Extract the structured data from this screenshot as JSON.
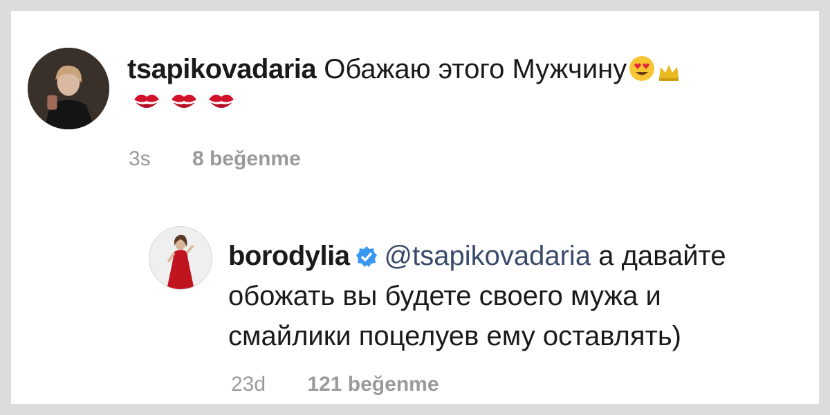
{
  "comment": {
    "username": "tsapikovadaria",
    "text": "Обажаю этого Мужчину",
    "emojis": [
      "heart-eyes-emoji",
      "crown-emoji",
      "kiss-mark-emoji",
      "kiss-mark-emoji",
      "kiss-mark-emoji"
    ],
    "time": "3s",
    "likes": "8 beğenme"
  },
  "reply": {
    "username": "borodylia",
    "verified": true,
    "mention": "@tsapikovadaria",
    "line1_rest": "а давайте",
    "line2": "обожать вы будете своего мужа и",
    "line3": "смайлики поцелуев ему оставлять)",
    "time": "23d",
    "likes": "121 beğenme"
  },
  "colors": {
    "background": "#dcdcdc",
    "card": "#ffffff",
    "text": "#1a1a1a",
    "meta": "#9a9a9a",
    "mention": "#3a4a6b",
    "verified": "#3897f0",
    "kiss": "#d0122a"
  }
}
